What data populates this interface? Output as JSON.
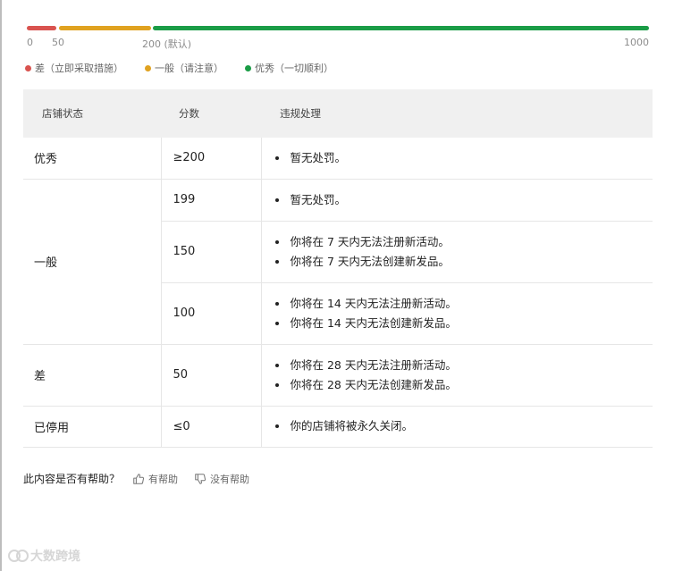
{
  "colors": {
    "poor": "#d9534f",
    "fair": "#e0a220",
    "excellent": "#1a9c46"
  },
  "scale": {
    "min": 0,
    "max": 1000,
    "segments": [
      {
        "name": "poor",
        "from": 0,
        "to": 50,
        "color": "#d9534f"
      },
      {
        "name": "fair",
        "from": 50,
        "to": 200,
        "color": "#e0a220"
      },
      {
        "name": "excellent",
        "from": 200,
        "to": 1000,
        "color": "#1a9c46"
      }
    ],
    "ticks": [
      "0",
      "50",
      "200 (默认)",
      "1000"
    ]
  },
  "legend": [
    {
      "label": "差（立即采取措施）",
      "color": "#d9534f"
    },
    {
      "label": "一般（请注意）",
      "color": "#e0a220"
    },
    {
      "label": "优秀（一切顺利）",
      "color": "#1a9c46"
    }
  ],
  "table": {
    "headers": [
      "店铺状态",
      "分数",
      "违规处理"
    ],
    "status": {
      "excellent": "优秀",
      "fair": "一般",
      "poor": "差",
      "deactivated": "已停用"
    },
    "scores": [
      "≥200",
      "199",
      "150",
      "100",
      "50",
      "≤0"
    ],
    "actions": {
      "r1": [
        "暂无处罚。"
      ],
      "r2": [
        "暂无处罚。"
      ],
      "r3": [
        "你将在 7 天内无法注册新活动。",
        "你将在 7 天内无法创建新发品。"
      ],
      "r4": [
        "你将在 14 天内无法注册新活动。",
        "你将在 14 天内无法创建新发品。"
      ],
      "r5": [
        "你将在 28 天内无法注册新活动。",
        "你将在 28 天内无法创建新发品。"
      ],
      "r6": [
        "你的店铺将被永久关闭。"
      ]
    }
  },
  "feedback": {
    "question": "此内容是否有帮助？",
    "yes": "有帮助",
    "no": "没有帮助"
  },
  "watermark": {
    "text": "大数跨境"
  }
}
